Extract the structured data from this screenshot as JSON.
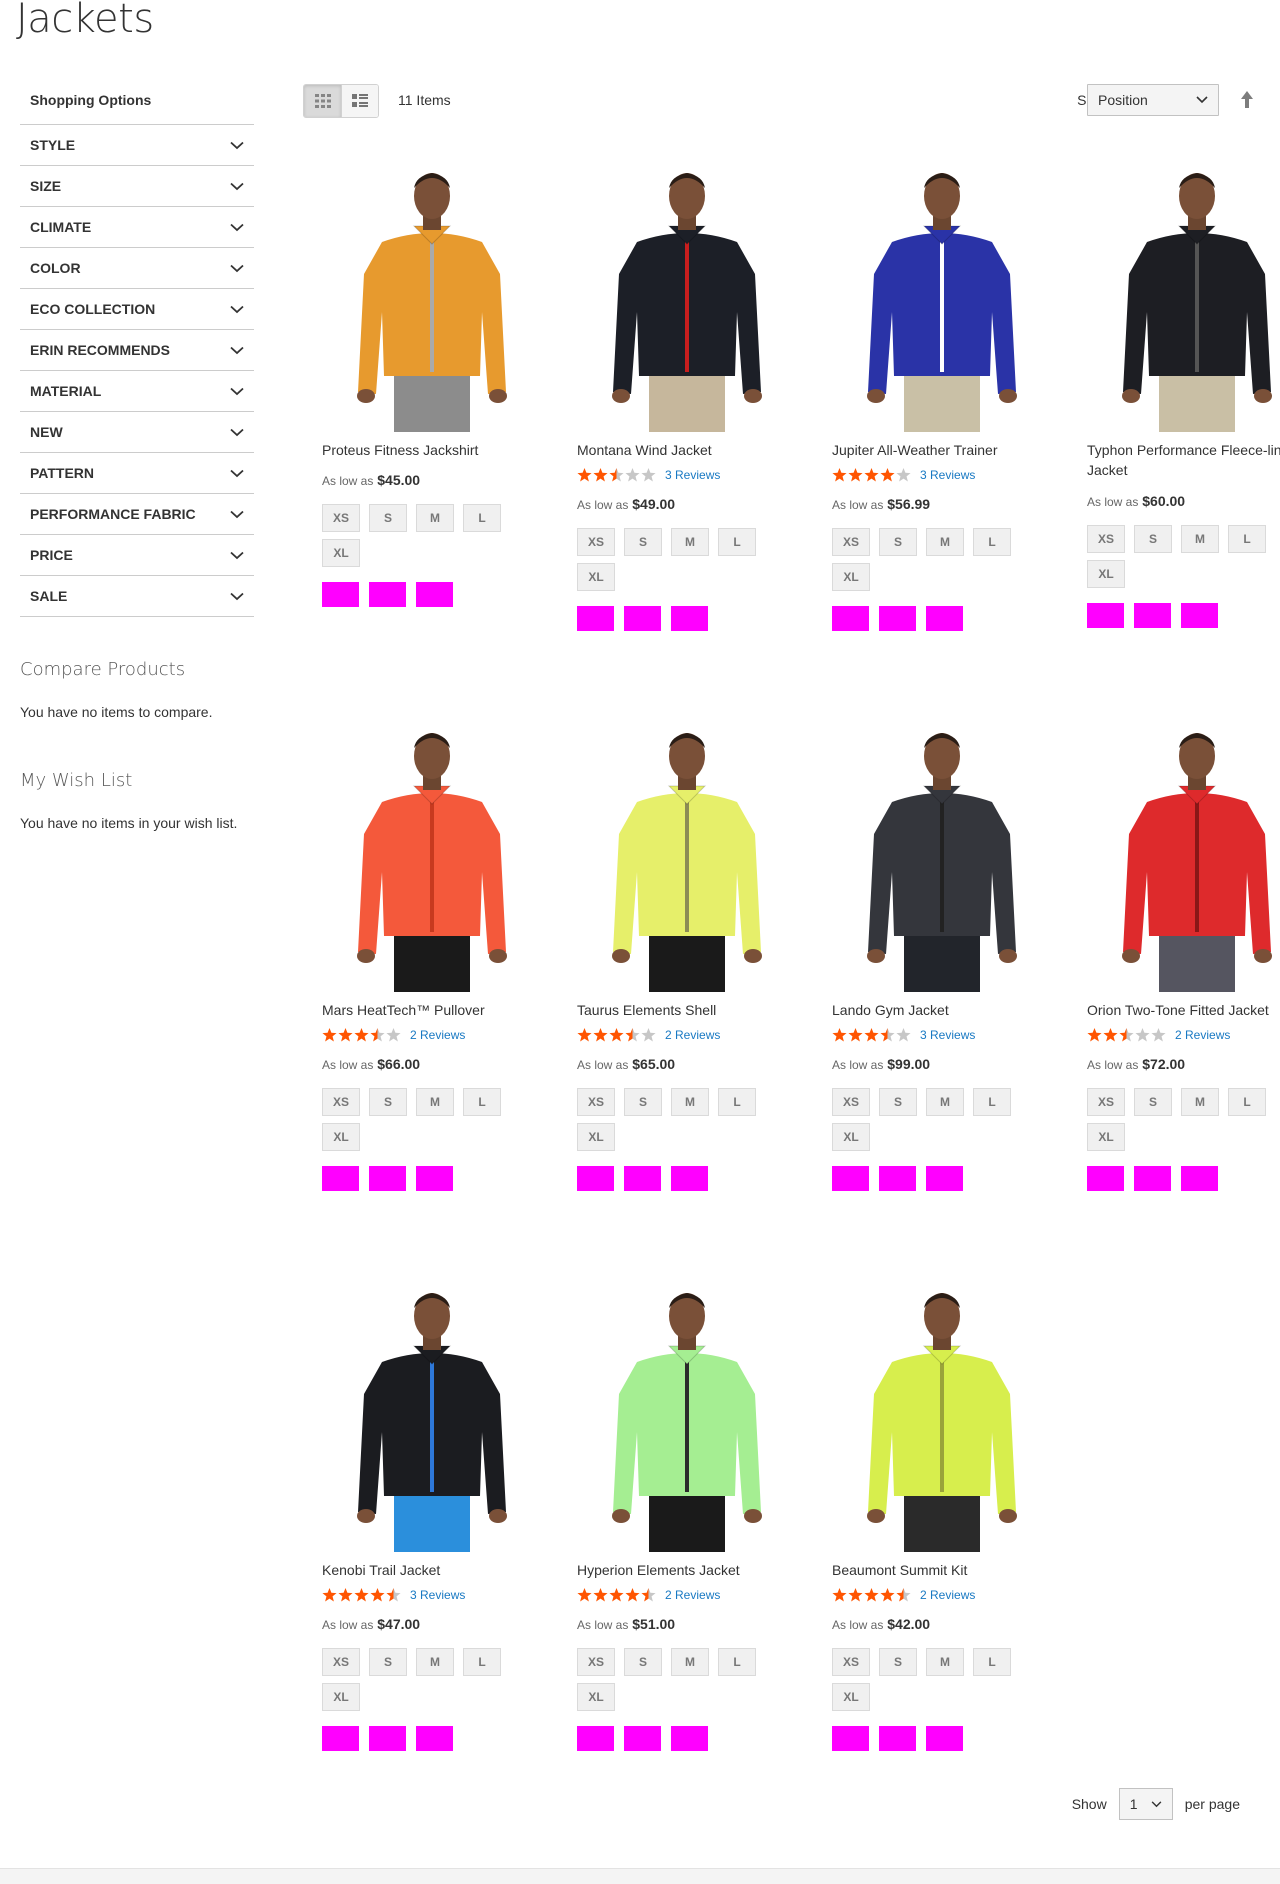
{
  "page": {
    "title": "Jackets"
  },
  "sidebar": {
    "title": "Shopping Options",
    "filters": [
      "Style",
      "Size",
      "Climate",
      "Color",
      "Eco Collection",
      "Erin Recommends",
      "Material",
      "New",
      "Pattern",
      "Performance Fabric",
      "Price",
      "Sale"
    ],
    "compare": {
      "title": "Compare Products",
      "text": "You have no items to compare."
    },
    "wishlist": {
      "title": "My Wish List",
      "text": "You have no items in your wish list."
    }
  },
  "toolbar": {
    "amount": "11 Items",
    "sort_label": "Sort By",
    "sort_value": "Position",
    "grid_mode": "grid-icon",
    "list_mode": "list-icon"
  },
  "limiter": {
    "show_label": "Show",
    "value": "1",
    "per_page_label": "per page"
  },
  "price_prefix": "As low as",
  "sizes": [
    "XS",
    "S",
    "M",
    "L",
    "XL"
  ],
  "colors": {
    "swatch": "#ff00ff",
    "star_on": "#ff5501",
    "star_off": "#c7c7c7",
    "link": "#1979c3"
  },
  "products": [
    {
      "name": "Proteus Fitness Jackshirt",
      "rating": null,
      "reviews": "",
      "price": "$45.00",
      "garment": "#e79a2e",
      "pants": "#8c8c8c",
      "zip": "#aaaaaa"
    },
    {
      "name": "Montana Wind Jacket",
      "rating": 2.5,
      "reviews": "3 Reviews",
      "price": "$49.00",
      "garment": "#1c1f27",
      "pants": "#c6b79c",
      "zip": "#c81e1e"
    },
    {
      "name": "Jupiter All-Weather Trainer",
      "rating": 4,
      "reviews": "3 Reviews",
      "price": "$56.99",
      "garment": "#2a33a7",
      "pants": "#c9c0a6",
      "zip": "#ffffff"
    },
    {
      "name": "Typhon Performance Fleece-lined Jacket",
      "rating": null,
      "reviews": "",
      "price": "$60.00",
      "garment": "#1d1e23",
      "pants": "#c9bfa5",
      "zip": "#555555"
    },
    {
      "name": "Mars HeatTech™ Pullover",
      "rating": 3.5,
      "reviews": "2 Reviews",
      "price": "$66.00",
      "garment": "#f4593b",
      "pants": "#1a1a1a",
      "zip": "#c73a1f"
    },
    {
      "name": "Taurus Elements Shell",
      "rating": 3.5,
      "reviews": "2 Reviews",
      "price": "$65.00",
      "garment": "#e6ef6a",
      "pants": "#1a1a1a",
      "zip": "#8c8c55"
    },
    {
      "name": "Lando Gym Jacket",
      "rating": 3.5,
      "reviews": "3 Reviews",
      "price": "$99.00",
      "garment": "#34363c",
      "pants": "#22252b",
      "zip": "#222222"
    },
    {
      "name": "Orion Two-Tone Fitted Jacket",
      "rating": 2.5,
      "reviews": "2 Reviews",
      "price": "$72.00",
      "garment": "#de2a2c",
      "pants": "#555560",
      "zip": "#8a1717"
    },
    {
      "name": "Kenobi Trail Jacket",
      "rating": 4.5,
      "reviews": "3 Reviews",
      "price": "$47.00",
      "garment": "#1b1c20",
      "pants": "#2b8fdc",
      "zip": "#2e78d9"
    },
    {
      "name": "Hyperion Elements Jacket",
      "rating": 4.5,
      "reviews": "2 Reviews",
      "price": "$51.00",
      "garment": "#a5ee92",
      "pants": "#1a1a1a",
      "zip": "#2b2b2b"
    },
    {
      "name": "Beaumont Summit Kit",
      "rating": 4.5,
      "reviews": "2 Reviews",
      "price": "$42.00",
      "garment": "#d7ee4d",
      "pants": "#2a2a2a",
      "zip": "#9aa33a"
    }
  ]
}
